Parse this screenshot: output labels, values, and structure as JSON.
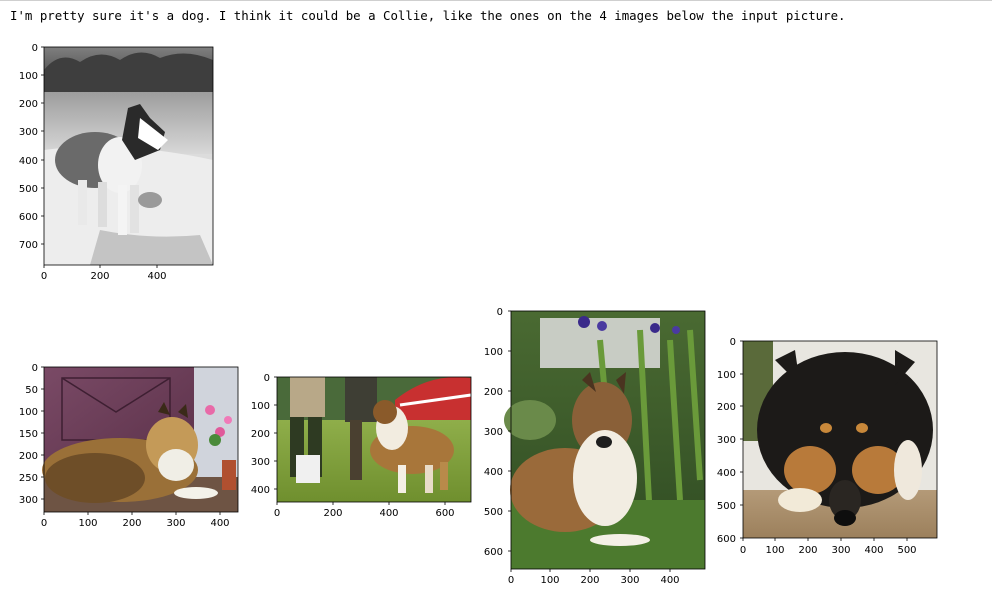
{
  "caption": "I'm pretty sure it's a dog. I think it could be a Collie, like the ones on the 4 images below the input picture.",
  "figures": [
    {
      "name": "input-picture",
      "description": "grayscale photo of a collie standing on a sandy shore with trees and water behind",
      "y_ticks": [
        "0",
        "100",
        "200",
        "300",
        "400",
        "500",
        "600",
        "700"
      ],
      "x_ticks": [
        "0",
        "200",
        "400"
      ]
    },
    {
      "name": "collie-1",
      "description": "sable collie lying on a porch in front of a purple door with pink flowers",
      "y_ticks": [
        "0",
        "50",
        "100",
        "150",
        "200",
        "250",
        "300"
      ],
      "x_ticks": [
        "0",
        "100",
        "200",
        "300",
        "400"
      ]
    },
    {
      "name": "collie-2",
      "description": "sable collie standing on grass at a dog show next to handlers and a red-white tent",
      "y_ticks": [
        "0",
        "100",
        "200",
        "300",
        "400"
      ],
      "x_ticks": [
        "0",
        "200",
        "400",
        "600"
      ]
    },
    {
      "name": "collie-3",
      "description": "sable and white collie lying in a garden with tall plants and blue iris flowers",
      "y_ticks": [
        "0",
        "100",
        "200",
        "300",
        "400",
        "500",
        "600"
      ],
      "x_ticks": [
        "0",
        "100",
        "200",
        "300",
        "400"
      ]
    },
    {
      "name": "collie-4",
      "description": "tricolor collie head resting on a wooden deck",
      "y_ticks": [
        "0",
        "100",
        "200",
        "300",
        "400",
        "500",
        "600"
      ],
      "x_ticks": [
        "0",
        "100",
        "200",
        "300",
        "400",
        "500"
      ]
    }
  ]
}
